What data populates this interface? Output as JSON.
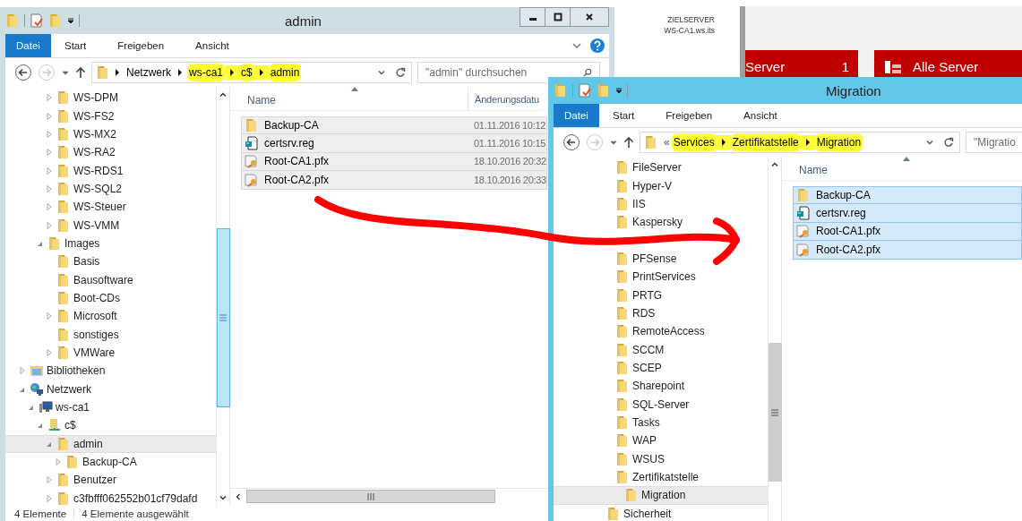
{
  "server_manager": {
    "target_label": "ZIELSERVER",
    "target_name": "WS-CA1.ws.its",
    "tiles": [
      {
        "kind": "count",
        "label": "Server",
        "count": "1"
      },
      {
        "kind": "group",
        "label": "Alle Server"
      }
    ]
  },
  "windows": [
    {
      "title": "admin",
      "active": false,
      "ribbon_tabs": [
        {
          "label": "Datei",
          "kind": "file"
        },
        {
          "label": "Start",
          "kind": "tab"
        },
        {
          "label": "Freigeben",
          "kind": "tab"
        },
        {
          "label": "Ansicht",
          "kind": "tab"
        }
      ],
      "address": {
        "crumbs": [
          {
            "label": "Netzwerk",
            "highlighted": false
          },
          {
            "label": "ws-ca1",
            "highlighted": true
          },
          {
            "label": "c$",
            "highlighted": true
          },
          {
            "label": "admin",
            "highlighted": true
          }
        ]
      },
      "search": {
        "placeholder": "\"admin\" durchsuchen"
      },
      "tree": [
        {
          "children": [
            {
              "children": [
                {
                  "children": [
                    {
                      "label": "WS-DPM",
                      "kind": "folder",
                      "expanded": false,
                      "selected": false
                    },
                    {
                      "label": "WS-FS2",
                      "kind": "folder",
                      "expanded": false,
                      "selected": false
                    },
                    {
                      "label": "WS-MX2",
                      "kind": "folder",
                      "expanded": false,
                      "selected": false
                    },
                    {
                      "label": "WS-RA2",
                      "kind": "folder",
                      "expanded": false,
                      "selected": false
                    },
                    {
                      "label": "WS-RDS1",
                      "kind": "folder",
                      "expanded": false,
                      "selected": false
                    },
                    {
                      "label": "WS-SQL2",
                      "kind": "folder",
                      "expanded": false,
                      "selected": false
                    },
                    {
                      "label": "WS-Steuer",
                      "kind": "folder",
                      "expanded": false,
                      "selected": false
                    },
                    {
                      "label": "WS-VMM",
                      "kind": "folder",
                      "expanded": false,
                      "selected": false
                    }
                  ]
                },
                {
                  "label": "Images",
                  "kind": "folder",
                  "expanded": true,
                  "selected": false,
                  "children": [
                    {
                      "label": "Basis",
                      "kind": "folder",
                      "selected": false
                    },
                    {
                      "label": "Bausoftware",
                      "kind": "folder",
                      "selected": false
                    },
                    {
                      "label": "Boot-CDs",
                      "kind": "folder",
                      "selected": false
                    },
                    {
                      "label": "Microsoft",
                      "kind": "folder",
                      "expanded": false,
                      "selected": false
                    },
                    {
                      "label": "sonstiges",
                      "kind": "folder",
                      "selected": false
                    },
                    {
                      "label": "VMWare",
                      "kind": "folder",
                      "expanded": false,
                      "selected": false
                    }
                  ]
                }
              ]
            }
          ]
        },
        {
          "label": "Bibliotheken",
          "kind": "library",
          "expanded": false,
          "selected": false
        },
        {
          "label": "Netzwerk",
          "kind": "network",
          "expanded": true,
          "selected": false,
          "children": [
            {
              "label": "ws-ca1",
              "kind": "computer",
              "expanded": true,
              "selected": false,
              "children": [
                {
                  "label": "c$",
                  "kind": "share",
                  "expanded": true,
                  "selected": false,
                  "children": [
                    {
                      "label": "admin",
                      "kind": "folder",
                      "expanded": true,
                      "selected": true,
                      "children": [
                        {
                          "label": "Backup-CA",
                          "kind": "folder",
                          "expanded": false,
                          "selected": false
                        }
                      ]
                    },
                    {
                      "label": "Benutzer",
                      "kind": "folder",
                      "expanded": false,
                      "selected": false
                    },
                    {
                      "label": "c3fbfff062552b01cf79dafd",
                      "kind": "folder",
                      "expanded": false,
                      "selected": false
                    }
                  ]
                }
              ]
            }
          ]
        }
      ],
      "columns": [
        "Name",
        "Änderungsdatu"
      ],
      "files": [
        {
          "name": "Backup-CA",
          "date": "01.11.2016 10:12",
          "kind": "folder",
          "selected": true
        },
        {
          "name": "certsrv.reg",
          "date": "01.11.2016 10:15",
          "kind": "reg",
          "selected": true
        },
        {
          "name": "Root-CA1.pfx",
          "date": "18.10.2016 20:32",
          "kind": "cert",
          "selected": true
        },
        {
          "name": "Root-CA2.pfx",
          "date": "18.10.2016 20:33",
          "kind": "cert",
          "selected": true
        }
      ],
      "status": [
        "4 Elemente",
        "4 Elemente ausgewählt"
      ]
    },
    {
      "title": "Migration",
      "active": true,
      "ribbon_tabs": [
        {
          "label": "Datei",
          "kind": "file"
        },
        {
          "label": "Start",
          "kind": "tab"
        },
        {
          "label": "Freigeben",
          "kind": "tab"
        },
        {
          "label": "Ansicht",
          "kind": "tab"
        }
      ],
      "address": {
        "overflow": "«",
        "crumbs": [
          {
            "label": "Services",
            "highlighted": true
          },
          {
            "label": "Zertifikatstelle",
            "highlighted": true
          },
          {
            "label": "Migration",
            "highlighted": true
          }
        ]
      },
      "search": {
        "placeholder": "\"Migratio"
      },
      "tree": [
        {
          "children": [
            {
              "label": "FileServer",
              "kind": "folder",
              "selected": false
            },
            {
              "label": "Hyper-V",
              "kind": "folder",
              "selected": false
            },
            {
              "label": "IIS",
              "kind": "folder",
              "selected": false
            },
            {
              "label": "Kaspersky",
              "kind": "folder",
              "selected": false
            },
            {
              "covered": true
            },
            {
              "label": "PFSense",
              "kind": "folder",
              "selected": false
            },
            {
              "label": "PrintServices",
              "kind": "folder",
              "selected": false
            },
            {
              "label": "PRTG",
              "kind": "folder",
              "selected": false
            },
            {
              "label": "RDS",
              "kind": "folder",
              "selected": false
            },
            {
              "label": "RemoteAccess",
              "kind": "folder",
              "selected": false
            },
            {
              "label": "SCCM",
              "kind": "folder",
              "selected": false
            },
            {
              "label": "SCEP",
              "kind": "folder",
              "selected": false
            },
            {
              "label": "Sharepoint",
              "kind": "folder",
              "selected": false
            },
            {
              "label": "SQL-Server",
              "kind": "folder",
              "selected": false
            },
            {
              "label": "Tasks",
              "kind": "folder",
              "selected": false
            },
            {
              "label": "WAP",
              "kind": "folder",
              "selected": false
            },
            {
              "label": "WSUS",
              "kind": "folder",
              "selected": false
            },
            {
              "label": "Zertifikatstelle",
              "kind": "folder",
              "selected": false,
              "children": [
                {
                  "label": "Migration",
                  "kind": "folder",
                  "selected": true
                }
              ]
            }
          ]
        },
        {
          "label": "Sicherheit",
          "kind": "folder",
          "selected": false
        }
      ],
      "columns": [
        "Name"
      ],
      "files": [
        {
          "name": "Backup-CA",
          "kind": "folder",
          "selected": true
        },
        {
          "name": "certsrv.reg",
          "kind": "reg",
          "selected": true
        },
        {
          "name": "Root-CA1.pfx",
          "kind": "cert",
          "selected": true
        },
        {
          "name": "Root-CA2.pfx",
          "kind": "cert",
          "selected": true
        }
      ]
    }
  ]
}
